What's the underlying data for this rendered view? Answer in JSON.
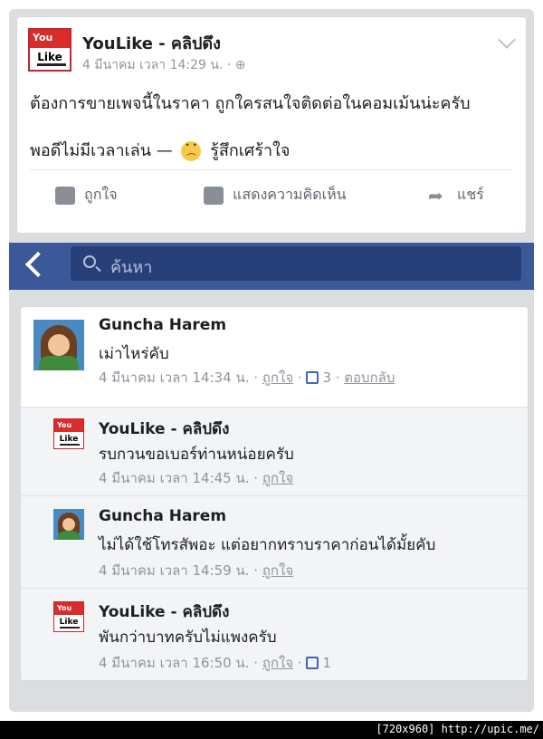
{
  "post": {
    "page_name": "YouLike - คลิปดึง",
    "logo_top": "You",
    "logo_bottom": "Like",
    "meta": "4 มีนาคม เวลา 14:29 น. · ",
    "text_line1": "ต้องการขายเพจนี้ในราคา ถูกใครสนใจติดต่อในคอมเม้นน่ะครับ",
    "text_line2_before": "พอดีไม่มีเวลาเล่น — ",
    "text_line2_after": " รู้สึกเศร้าใจ",
    "actions": {
      "like": "ถูกใจ",
      "comment": "แสดงความคิดเห็น",
      "share": "แชร์"
    }
  },
  "search": {
    "placeholder": "ค้นหา"
  },
  "comments": [
    {
      "author": "Guncha Harem",
      "text": "เม่าไหร่คับ",
      "time": "4 มีนาคม เวลา 14:34 น.",
      "like_label": "ถูกใจ",
      "likes": "3",
      "reply_label": "ตอบกลับ"
    },
    {
      "author": "YouLike - คลิปดึง",
      "text": "รบกวนขอเบอร์ท่านหน่อยครับ",
      "time": "4 มีนาคม เวลา 14:45 น.",
      "like_label": "ถูกใจ"
    },
    {
      "author": "Guncha Harem",
      "text": "ไม่ได้ใช้โทรสัพอะ แต่อยากทราบราคาก่อนได้มั้ยคับ",
      "time": "4 มีนาคม เวลา 14:59 น.",
      "like_label": "ถูกใจ"
    },
    {
      "author": "YouLike - คลิปดึง",
      "text": "พันกว่าบาทครับไม่แพงครับ",
      "time": "4 มีนาคม เวลา 16:50 น.",
      "like_label": "ถูกใจ",
      "likes": "1"
    }
  ],
  "watermark": "[720x960] http://upic.me/",
  "colors": {
    "header": "#3b5998",
    "link": "#4267b2"
  }
}
